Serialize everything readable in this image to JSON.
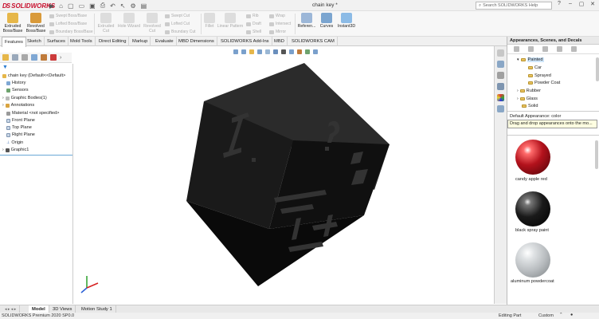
{
  "app": {
    "brand": "SOLIDWORKS",
    "doc_title": "chain key *",
    "search_placeholder": "Search SOLIDWORKS Help"
  },
  "colors": {
    "brand_red": "#c8102e",
    "accent_blue": "#1f6fb5",
    "highlight": "#cfe6fa",
    "tooltip_bg": "#ffffe1"
  },
  "ribbon": {
    "extruded": "Extruded Boss/Base",
    "revolved": "Revolved Boss/Base",
    "swept_boss": "Swept Boss/Base",
    "lofted_boss": "Lofted Boss/Base",
    "boundary_boss": "Boundary Boss/Base",
    "extruded_cut": "Extruded Cut",
    "hole_wizard": "Hole Wizard",
    "revolved_cut": "Revolved Cut",
    "swept_cut": "Swept Cut",
    "lofted_cut": "Lofted Cut",
    "boundary_cut": "Boundary Cut",
    "fillet": "Fillet",
    "linear_pattern": "Linear Pattern",
    "rib": "Rib",
    "draft": "Draft",
    "shell": "Shell",
    "wrap": "Wrap",
    "intersect": "Intersect",
    "mirror": "Mirror",
    "reference": "Referen...",
    "curves": "Curves",
    "instant3d": "Instant3D"
  },
  "command_tabs": [
    "Features",
    "Sketch",
    "Surfaces",
    "Mold Tools",
    "Direct Editing",
    "Markup",
    "Evaluate",
    "MBD Dimensions",
    "SOLIDWORKS Add-Ins",
    "MBD",
    "SOLIDWORKS CAM"
  ],
  "tree": {
    "root": "chain key  (Default<<Default>",
    "items": [
      "History",
      "Sensors",
      "Graphic Bodies(1)",
      "Annotations",
      "Material <not specified>",
      "Front Plane",
      "Top Plane",
      "Right Plane",
      "Origin",
      "Graphic1"
    ]
  },
  "bottom_tabs": [
    "Model",
    "3D Views",
    "Motion Study 1"
  ],
  "status": {
    "left": "SOLIDWORKS Premium 2020 SP0.0",
    "mode": "Editing Part",
    "units": "Custom"
  },
  "appearances": {
    "header": "Appearances, Scenes, and Decals",
    "tree": [
      "Painted",
      "Car",
      "Sprayed",
      "Powder Coat",
      "Rubber",
      "Glass",
      "Solid"
    ],
    "default_label": "Default Appearance: color",
    "tooltip": "Drag and drop appearances onto the mo...",
    "swatches": [
      {
        "label": "candy apple red",
        "color": "#b3121c"
      },
      {
        "label": "black spray paint",
        "color": "#1a1a1a"
      },
      {
        "label": "aluminum powdercoat",
        "color": "#b8bcbf"
      }
    ]
  }
}
